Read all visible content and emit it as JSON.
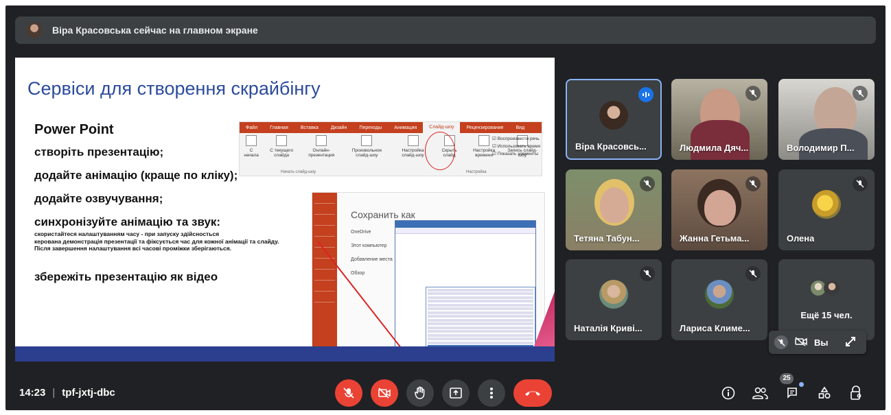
{
  "banner": {
    "text": "Віра Красовська сейчас на главном экране"
  },
  "slide": {
    "title": "Сервіси для створення скрайбінгу",
    "subtitle": "Power Point",
    "steps": [
      "створіть презентацію;",
      "додайте анімацію (краще по кліку);",
      "додайте озвучування;",
      "синхронізуйте анімацію та звук:"
    ],
    "note_lines": [
      "скористайтеся налаштуванням часу - при запуску здійсносться",
      "керована демонстрація презентації та фіксується час для кожної анімації та слайду.",
      "Після завершення налаштування всі часові проміжки зберігаються."
    ],
    "final_step": "збережіть презентацію як відео",
    "ribbon": {
      "tabs": [
        "Файл",
        "Главная",
        "Вставка",
        "Дизайн",
        "Переходы",
        "Анимация",
        "Слайд-шоу",
        "Рецензирование",
        "Вид"
      ],
      "buttons": [
        "С начала",
        "С текущего слайда",
        "Онлайн-презентация",
        "Произвольное слайд-шоу",
        "Настройка слайд-шоу",
        "Скрыть слайд",
        "Настройка времени",
        "Запись слайд-шоу"
      ],
      "group1": "Начать слайд-шоу",
      "group2": "Настройка",
      "checks": [
        "Воспроизвести речь",
        "Использовать время",
        "Показать элементы"
      ]
    },
    "saveas": {
      "heading": "Сохранить как",
      "locations": [
        "OneDrive",
        "Этот компьютер",
        "Добавление места",
        "Обзор"
      ]
    }
  },
  "participants": [
    {
      "name": "Віра Красовсь...",
      "state": "speaking"
    },
    {
      "name": "Людмила Дяч...",
      "state": "muted"
    },
    {
      "name": "Володимир П...",
      "state": "muted"
    },
    {
      "name": "Тетяна Табун...",
      "state": "muted"
    },
    {
      "name": "Жанна Гетьма...",
      "state": "muted"
    },
    {
      "name": "Олена",
      "state": "muted"
    },
    {
      "name": "Наталія Криві...",
      "state": "muted"
    },
    {
      "name": "Лариса Климе...",
      "state": "muted"
    }
  ],
  "more": {
    "text": "Ещё 15 чел."
  },
  "self": {
    "label": "Вы"
  },
  "bottom": {
    "time": "14:23",
    "code": "tpf-jxtj-dbc",
    "people_count": "25"
  },
  "colors": {
    "accent_red": "#ea4335",
    "bg": "#202124",
    "tile": "#3c4043",
    "speak": "#1a73e8"
  }
}
